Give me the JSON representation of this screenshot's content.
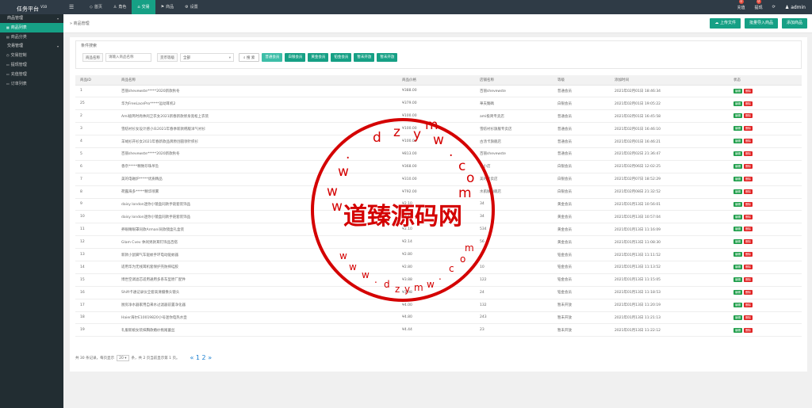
{
  "brand": {
    "name": "任务平台",
    "version": "V10"
  },
  "topnav": [
    {
      "icon": "◇",
      "label": "首页",
      "active": false
    },
    {
      "icon": "♙",
      "label": "角色",
      "active": false
    },
    {
      "icon": "⌂",
      "label": "交易",
      "active": true
    },
    {
      "icon": "⚑",
      "label": "商品",
      "active": false
    },
    {
      "icon": "⚙",
      "label": "设置",
      "active": false
    }
  ],
  "topright": {
    "recharge": {
      "label": "充值",
      "badge": "0"
    },
    "withdraw": {
      "label": "提现",
      "badge": "0"
    },
    "refresh_icon": "⟳",
    "user": "admin"
  },
  "sidebar": {
    "groups": [
      {
        "label": "商品管理",
        "items": [
          {
            "label": "商品列表",
            "icon": "▦",
            "active": true
          },
          {
            "label": "商品分类",
            "icon": "▤",
            "active": false
          }
        ]
      },
      {
        "label": "交易管理",
        "items": [
          {
            "label": "交易控制",
            "icon": "◷",
            "active": false
          },
          {
            "label": "提现管理",
            "icon": "▭",
            "active": false
          },
          {
            "label": "充值管理",
            "icon": "▭",
            "active": false
          },
          {
            "label": "订单列表",
            "icon": "▭",
            "active": false
          }
        ]
      }
    ]
  },
  "crumb": {
    "label": "» 商品管理"
  },
  "actions": {
    "upload": "上传文件",
    "batch_import": "批量导入商品",
    "add": "添加商品"
  },
  "filter": {
    "legend": "条件搜索",
    "name_label": "商品名称",
    "name_placeholder": "请输入商品名称",
    "level_label": "货币等级",
    "level_value": "全部",
    "search_label": "搜 索",
    "tags": [
      "普通会员",
      "白银会员",
      "黄金会员",
      "铂金会员",
      "暂未开放",
      "暂未开放"
    ]
  },
  "table": {
    "headers": [
      "商品ID",
      "商品名称",
      "商品价格",
      "店铺名称",
      "等级",
      "添加时间",
      "状态"
    ],
    "edit_label": "编辑",
    "delete_label": "删除",
    "rows": [
      [
        "1",
        "百丽shevewste*****2020新款秋冬",
        "¥388.00",
        "百丽shevewste",
        "普通会员",
        "2021年02月01日 18:46:34"
      ],
      [
        "25",
        "华为FreeLacePro*****运动耳机2",
        "¥379.00",
        "華夫麵碼",
        "白银会员",
        "2021年02月01日 19:05:22"
      ],
      [
        "2",
        "Ami极简时尚休闲卫衣女2021新春新款修身宽松上衣装",
        "¥100.00",
        "ami极简专卖店",
        "普通会员",
        "2021年02月01日 16:45:58"
      ],
      [
        "3",
        "雪纺衬衫女设计感小众2021年春季新款韩版洋气衬衫",
        "¥100.00",
        "雪纺衬衫旗舰专卖店",
        "普通会员",
        "2021年02月01日 16:46:10"
      ],
      [
        "4",
        "羊绒衫开衫女2021年春新款品牌原创圆领针织衫",
        "¥100.00",
        "古汤卡旗舰店",
        "普通会员",
        "2021年02月01日 16:46:21"
      ],
      [
        "5",
        "百丽shevewste*****2020新款秋冬",
        "¥813.00",
        "百丽shevewste",
        "普通会员",
        "2021年02月02日 21:36:47"
      ],
      [
        "6",
        "香奈*****精致珍珠吊坠",
        "¥368.00",
        "小小店",
        "白银会员",
        "2021年02月06日 12:02:25"
      ],
      [
        "7",
        "美的电磁炉*****优质精品",
        "¥310.00",
        "美的专卖店",
        "白银会员",
        "2021年02月07日 18:52:29"
      ],
      [
        "8",
        "荷露海多*****精华喷雾",
        "¥792.00",
        "水肌肤旗舰店",
        "白银会员",
        "2021年02月08日 21:32:52"
      ],
      [
        "9",
        "daisy london迷你小镜盒同款手链套装饰品",
        "¥2.10",
        "34",
        "黄金会员",
        "2021年01月13日 10:56:01"
      ],
      [
        "10",
        "daisy london迷你小镜盒同款手链套装饰品",
        "¥2.10",
        "34",
        "黄金会员",
        "2021年01月13日 10:57:04"
      ],
      [
        "11",
        "养眼睛眼罩同款Armani同款镜盒礼盒装",
        "¥2.10",
        "534",
        "黄金会员",
        "2021年01月13日 11:16:09"
      ],
      [
        "12",
        "Glam Cvev 休闲男款耳钉饰品百搭",
        "¥2.14",
        "56",
        "黄金会员",
        "2021年01月13日 11:08:30"
      ],
      [
        "13",
        "新款小鼠脚气车驱蚊手环电动驱蚊器",
        "¥2.80",
        "",
        "铂金会员",
        "2021年01月13日 11:11:52"
      ],
      [
        "14",
        "适用华为无线耳机套保护壳防摔硅胶",
        "¥2.80",
        "10",
        "铂金会员",
        "2021年01月13日 11:13:52"
      ],
      [
        "15",
        "博世空调滤芯适用通用多系车型原厂配件",
        "¥3.88",
        "122",
        "铂金会员",
        "2021年01月13日 11:15:05"
      ],
      [
        "16",
        "Shift卡通记录仪全套高清摄像头镜头",
        "¥3.98",
        "24",
        "铂金会员",
        "2021年01月13日 11:18:53"
      ],
      [
        "17",
        "厨房净水器家用自来水过滤器前置净化器",
        "¥4.00",
        "132",
        "暂未开放",
        "2021年01月13日 11:20:19"
      ],
      [
        "18",
        "Haier海尔E10019820小号迷你电热水壶",
        "¥4.80",
        "243",
        "暂未开放",
        "2021年01月13日 11:21:13"
      ],
      [
        "19",
        "礼服新娘女装抹胸款婚纱拖尾蕾丝",
        "¥4.44",
        "23",
        "暂未开放",
        "2021年01月13日 11:22:12"
      ]
    ]
  },
  "pager": {
    "summary_prefix": "共 30 条记录，每页显示",
    "page_size": "20",
    "summary_suffix": "条，共 2 页当前显示第 1 页。",
    "pages": "« 1 2 »"
  },
  "watermark": {
    "domain": "dzymw.com",
    "brand": "道臻源码网"
  }
}
